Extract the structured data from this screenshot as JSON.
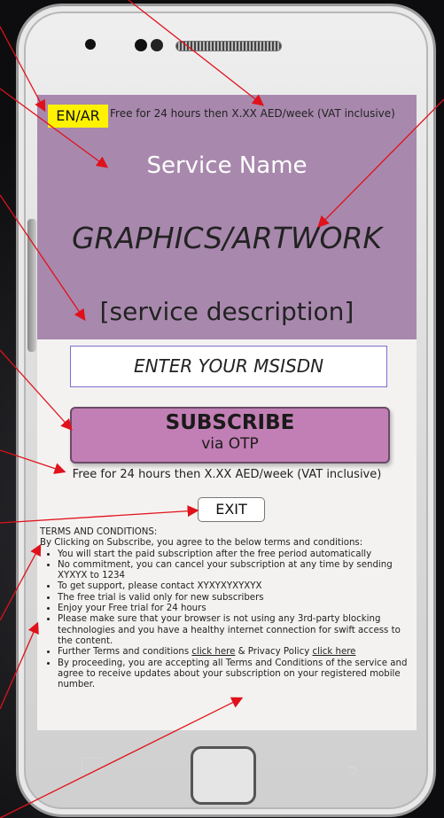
{
  "hero": {
    "lang_toggle": "EN/AR",
    "price_note": "Free for 24 hours then X.XX AED/week (VAT inclusive)",
    "service_name": "Service Name",
    "graphics": "GRAPHICS/ARTWORK",
    "description": "[service description]"
  },
  "form": {
    "msisdn_placeholder": "ENTER YOUR MSISDN",
    "subscribe_label": "SUBSCRIBE",
    "subscribe_sub": "via OTP",
    "price_note": "Free for 24 hours then X.XX AED/week (VAT inclusive)",
    "exit_label": "EXIT"
  },
  "terms": {
    "heading": "TERMS AND CONDITIONS:",
    "intro": "By Clicking on Subscribe, you agree to the below terms and conditions:",
    "items": [
      "You will start the paid subscription after the free period automatically",
      "No commitment, you can cancel your subscription at any time by sending XYXYX to 1234",
      "To get support, please contact XYXYXYXYXYX",
      "The free trial is valid only for new subscribers",
      "Enjoy your Free trial for 24 hours",
      "Please make sure that your browser is not using any 3rd-party blocking technologies and you have a healthy internet connection for swift access to the content."
    ],
    "further_prefix": "Further Terms and conditions",
    "link_terms": "click here",
    "further_mid": "& Privacy Policy",
    "link_privacy": "click here",
    "final_item": "By proceeding, you are accepting all Terms and Conditions of the service and agree to receive updates about your subscription on your registered mobile number."
  },
  "colors": {
    "hero_bg": "#a889ad",
    "lang_bg": "#fff200",
    "subscribe_bg": "#c27fb5",
    "arrow": "#e0111b"
  }
}
